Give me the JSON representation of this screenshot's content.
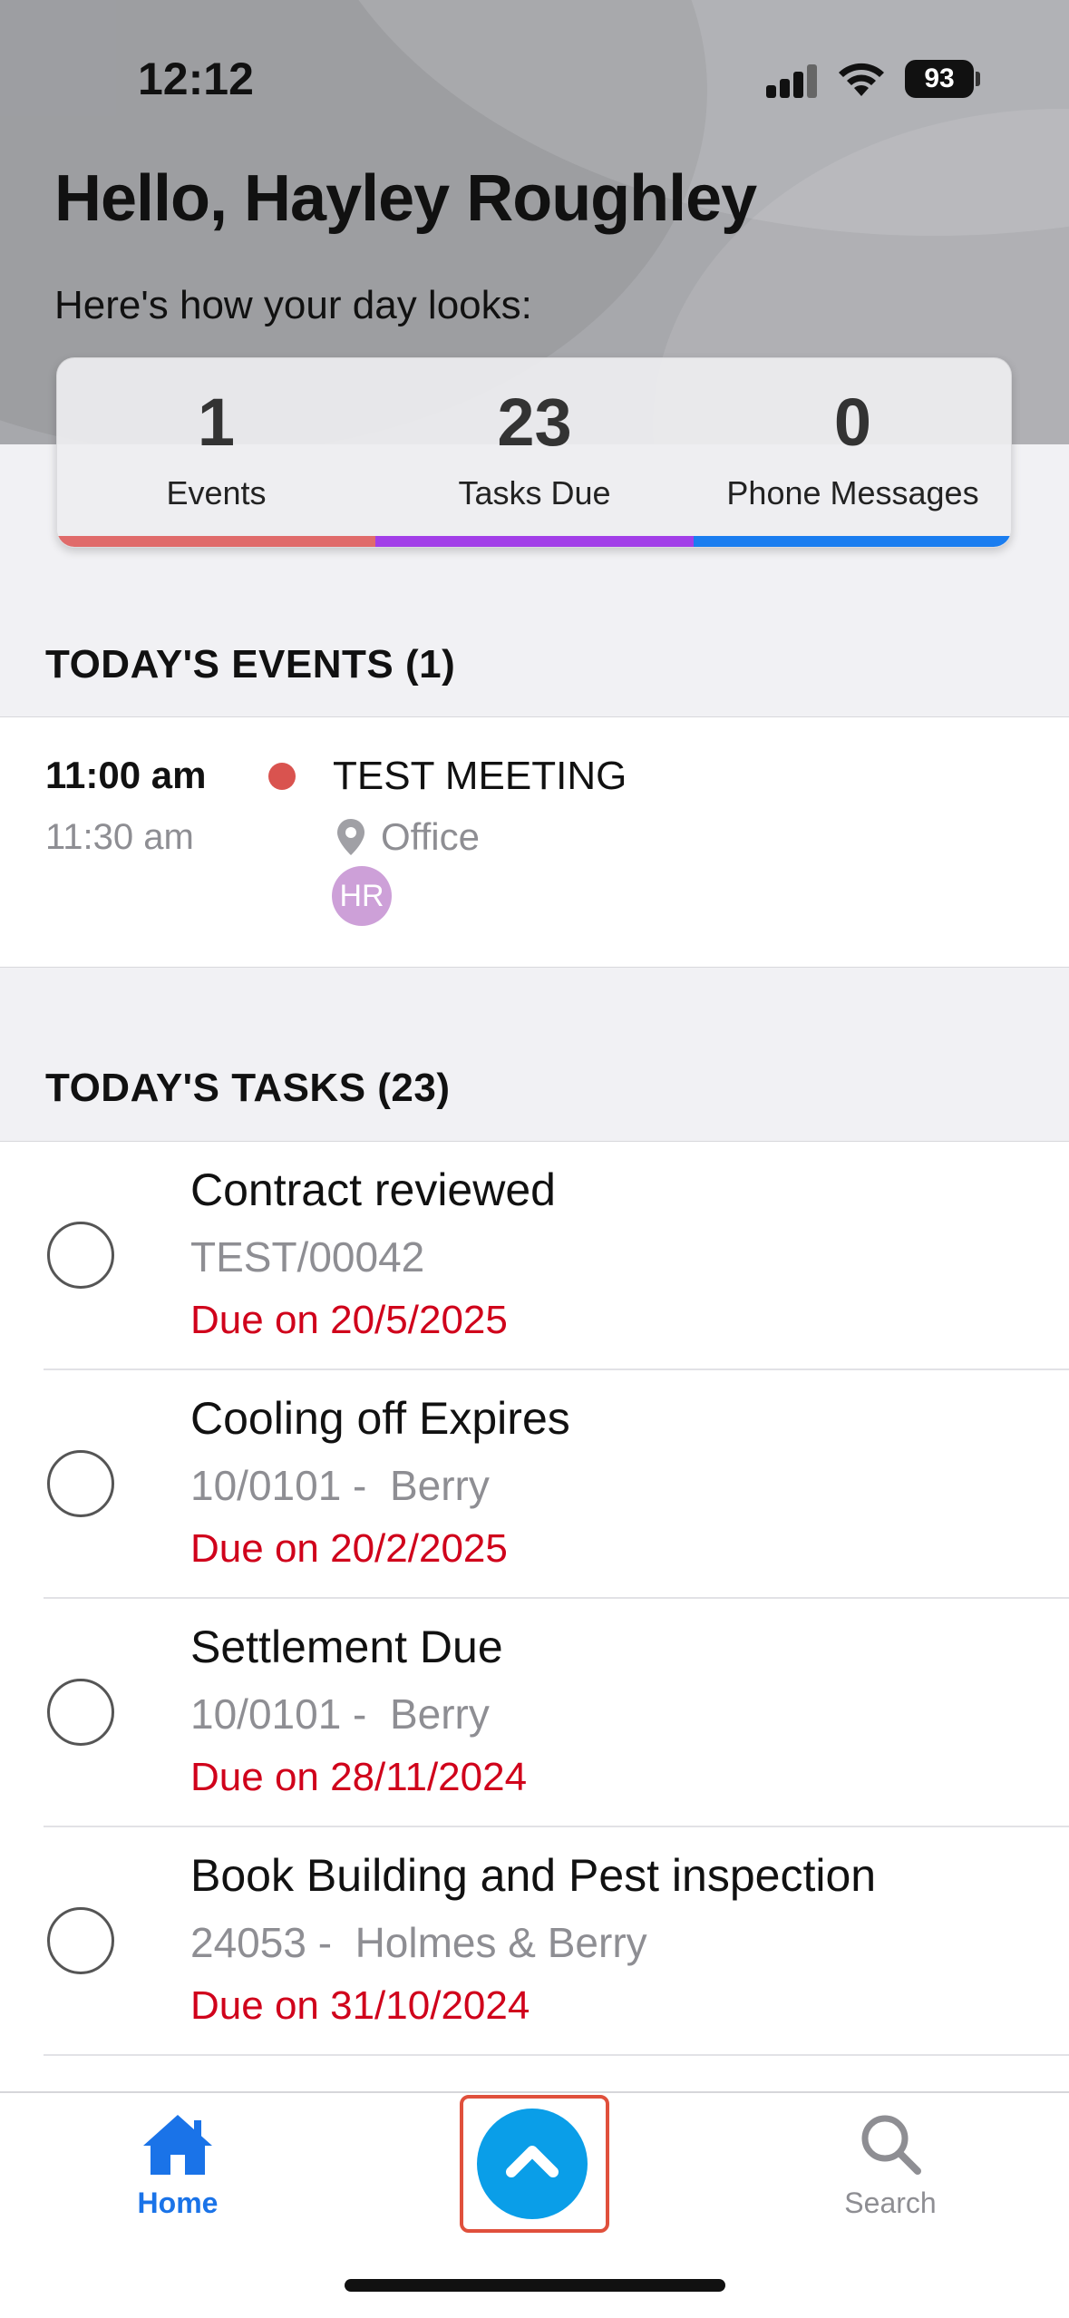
{
  "status_bar": {
    "time": "12:12",
    "battery": "93"
  },
  "header": {
    "greeting": "Hello, Hayley Roughley",
    "subtitle": "Here's how your day looks:"
  },
  "summary": [
    {
      "value": "1",
      "label": "Events",
      "color": "#e06b6b"
    },
    {
      "value": "23",
      "label": "Tasks Due",
      "color": "#a23ee8"
    },
    {
      "value": "0",
      "label": "Phone Messages",
      "color": "#1a7df0"
    }
  ],
  "events_section": {
    "title": "TODAY'S EVENTS (1)",
    "items": [
      {
        "start": "11:00 am",
        "end": "11:30 am",
        "title": "TEST MEETING",
        "location": "Office",
        "attendee_initials": "HR",
        "dot_color": "#d9534f"
      }
    ]
  },
  "tasks_section": {
    "title": "TODAY'S TASKS (23)",
    "items": [
      {
        "title": "Contract reviewed",
        "ref": "TEST/00042",
        "due": "Due on 20/5/2025"
      },
      {
        "title": "Cooling off Expires",
        "ref": "10/0101 -  Berry",
        "due": "Due on 20/2/2025"
      },
      {
        "title": "Settlement Due",
        "ref": "10/0101 -  Berry",
        "due": "Due on 28/11/2024"
      },
      {
        "title": "Book Building and Pest inspection",
        "ref": "24053 -  Holmes & Berry",
        "due": "Due on 31/10/2024"
      }
    ]
  },
  "tab_bar": {
    "home_label": "Home",
    "search_label": "Search",
    "accent": "#1a73e8"
  }
}
